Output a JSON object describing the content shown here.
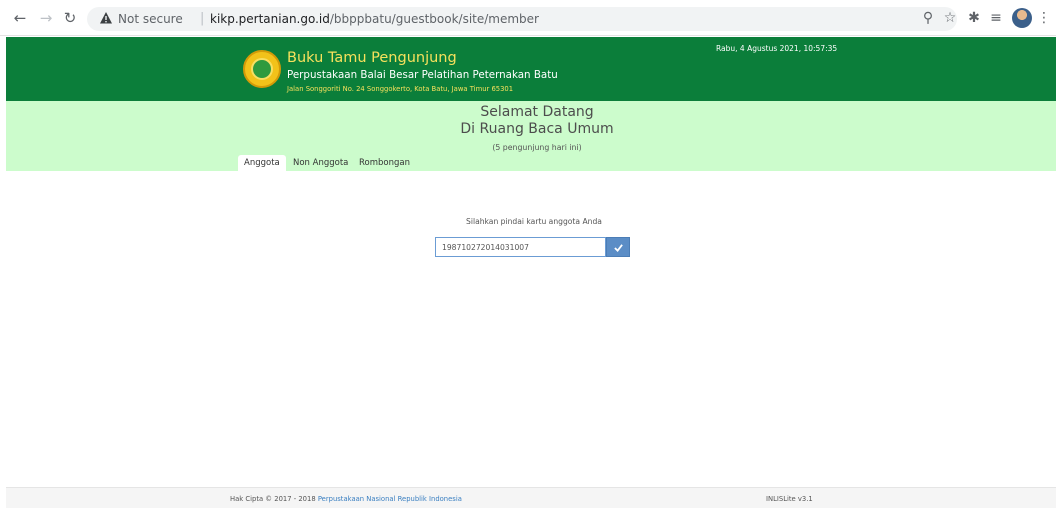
{
  "browser": {
    "not_secure_label": "Not secure",
    "url_host": "kikp.pertanian.go.id",
    "url_path": "/bbppbatu/guestbook/site/member"
  },
  "header": {
    "title": "Buku Tamu Pengunjung",
    "subtitle": "Perpustakaan Balai Besar Pelatihan Peternakan Batu",
    "address": "Jalan Songgoriti No. 24 Songgokerto, Kota Batu, Jawa Timur 65301",
    "datetime": "Rabu, 4 Agustus 2021, 10:57:35"
  },
  "welcome": {
    "line1": "Selamat Datang",
    "line2": "Di Ruang Baca Umum",
    "visitor_count": "(5 pengunjung hari ini)"
  },
  "tabs": [
    {
      "label": "Anggota",
      "active": true
    },
    {
      "label": "Non Anggota",
      "active": false
    },
    {
      "label": "Rombongan",
      "active": false
    }
  ],
  "form": {
    "prompt": "Silahkan pindai kartu anggota Anda",
    "member_value": "198710272014031007"
  },
  "footer": {
    "copyright_prefix": "Hak Cipta © 2017 - 2018",
    "copyright_link": "Perpustakaan Nasional Republik Indonesia",
    "version": "INLISLite v3.1"
  },
  "colors": {
    "header_green": "#0b7e3a",
    "band_green": "#ccfccc",
    "title_yellow": "#f6e15c",
    "button_blue": "#5b8dc6"
  }
}
